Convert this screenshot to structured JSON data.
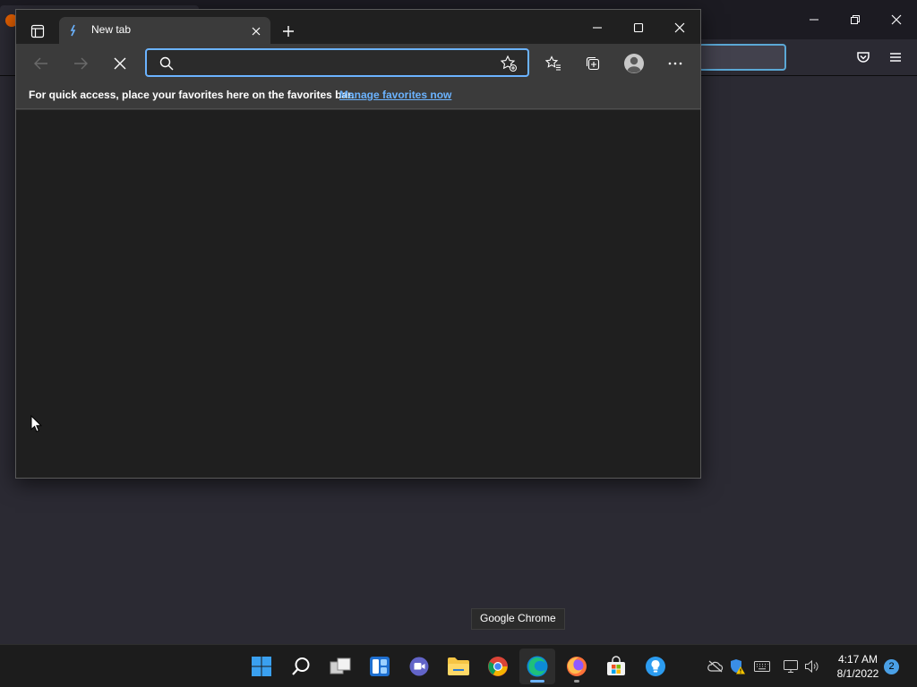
{
  "edge": {
    "tab": {
      "title": "New tab"
    },
    "address": {
      "value": "",
      "placeholder": ""
    },
    "favorites_bar": {
      "message": "For quick access, place your favorites here on the favorites bar.",
      "link": "Manage favorites now"
    },
    "toolbar_icons": [
      "back-arrow-icon",
      "forward-arrow-icon",
      "stop-loading-icon",
      "search-icon",
      "add-favorite-icon",
      "favorites-icon",
      "collections-icon",
      "profile-icon",
      "more-icon"
    ],
    "window_controls": [
      "minimize-icon",
      "maximize-icon",
      "close-icon"
    ]
  },
  "firefox_background": {
    "icons": [
      "firefox-icon",
      "minimize-icon",
      "restore-icon",
      "close-icon",
      "pocket-icon",
      "menu-icon"
    ]
  },
  "tooltip": {
    "text": "Google Chrome"
  },
  "taskbar": {
    "apps": [
      {
        "name": "Start",
        "icon": "windows-start-icon"
      },
      {
        "name": "Search",
        "icon": "search-icon"
      },
      {
        "name": "Task View",
        "icon": "task-view-icon"
      },
      {
        "name": "Widgets",
        "icon": "widgets-icon"
      },
      {
        "name": "Chat",
        "icon": "teams-chat-icon"
      },
      {
        "name": "File Explorer",
        "icon": "file-explorer-icon"
      },
      {
        "name": "Google Chrome",
        "icon": "chrome-icon"
      },
      {
        "name": "Microsoft Edge",
        "icon": "edge-icon",
        "active": true
      },
      {
        "name": "Firefox",
        "icon": "firefox-icon",
        "running": true
      },
      {
        "name": "Microsoft Store",
        "icon": "store-icon"
      },
      {
        "name": "Tips",
        "icon": "tips-icon"
      }
    ],
    "tray_icons": [
      "onedrive-offline-icon",
      "security-warning-icon",
      "keyboard-icon",
      "network-icon",
      "volume-icon"
    ],
    "clock": {
      "time": "4:17 AM",
      "date": "8/1/2022"
    },
    "notification_count": "2"
  },
  "colors": {
    "desktop_bg": "#2b2a33",
    "edge_frame": "#3b3b3b",
    "edge_content": "#1f1f1f",
    "accent": "#6bb3ff",
    "taskbar_bg": "#1c1c1c"
  }
}
